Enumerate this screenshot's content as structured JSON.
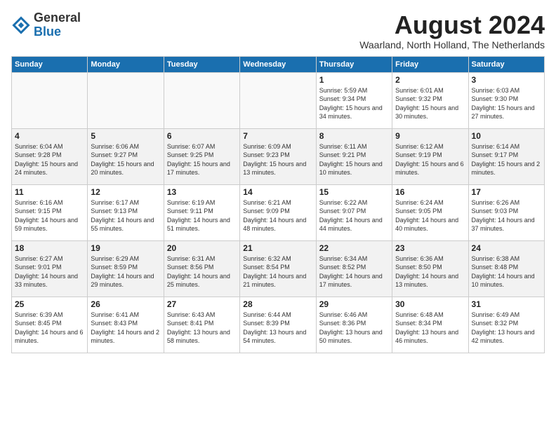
{
  "header": {
    "logo_general": "General",
    "logo_blue": "Blue",
    "month": "August 2024",
    "location": "Waarland, North Holland, The Netherlands"
  },
  "weekdays": [
    "Sunday",
    "Monday",
    "Tuesday",
    "Wednesday",
    "Thursday",
    "Friday",
    "Saturday"
  ],
  "weeks": [
    [
      {
        "day": "",
        "info": ""
      },
      {
        "day": "",
        "info": ""
      },
      {
        "day": "",
        "info": ""
      },
      {
        "day": "",
        "info": ""
      },
      {
        "day": "1",
        "info": "Sunrise: 5:59 AM\nSunset: 9:34 PM\nDaylight: 15 hours and 34 minutes."
      },
      {
        "day": "2",
        "info": "Sunrise: 6:01 AM\nSunset: 9:32 PM\nDaylight: 15 hours and 30 minutes."
      },
      {
        "day": "3",
        "info": "Sunrise: 6:03 AM\nSunset: 9:30 PM\nDaylight: 15 hours and 27 minutes."
      }
    ],
    [
      {
        "day": "4",
        "info": "Sunrise: 6:04 AM\nSunset: 9:28 PM\nDaylight: 15 hours and 24 minutes."
      },
      {
        "day": "5",
        "info": "Sunrise: 6:06 AM\nSunset: 9:27 PM\nDaylight: 15 hours and 20 minutes."
      },
      {
        "day": "6",
        "info": "Sunrise: 6:07 AM\nSunset: 9:25 PM\nDaylight: 15 hours and 17 minutes."
      },
      {
        "day": "7",
        "info": "Sunrise: 6:09 AM\nSunset: 9:23 PM\nDaylight: 15 hours and 13 minutes."
      },
      {
        "day": "8",
        "info": "Sunrise: 6:11 AM\nSunset: 9:21 PM\nDaylight: 15 hours and 10 minutes."
      },
      {
        "day": "9",
        "info": "Sunrise: 6:12 AM\nSunset: 9:19 PM\nDaylight: 15 hours and 6 minutes."
      },
      {
        "day": "10",
        "info": "Sunrise: 6:14 AM\nSunset: 9:17 PM\nDaylight: 15 hours and 2 minutes."
      }
    ],
    [
      {
        "day": "11",
        "info": "Sunrise: 6:16 AM\nSunset: 9:15 PM\nDaylight: 14 hours and 59 minutes."
      },
      {
        "day": "12",
        "info": "Sunrise: 6:17 AM\nSunset: 9:13 PM\nDaylight: 14 hours and 55 minutes."
      },
      {
        "day": "13",
        "info": "Sunrise: 6:19 AM\nSunset: 9:11 PM\nDaylight: 14 hours and 51 minutes."
      },
      {
        "day": "14",
        "info": "Sunrise: 6:21 AM\nSunset: 9:09 PM\nDaylight: 14 hours and 48 minutes."
      },
      {
        "day": "15",
        "info": "Sunrise: 6:22 AM\nSunset: 9:07 PM\nDaylight: 14 hours and 44 minutes."
      },
      {
        "day": "16",
        "info": "Sunrise: 6:24 AM\nSunset: 9:05 PM\nDaylight: 14 hours and 40 minutes."
      },
      {
        "day": "17",
        "info": "Sunrise: 6:26 AM\nSunset: 9:03 PM\nDaylight: 14 hours and 37 minutes."
      }
    ],
    [
      {
        "day": "18",
        "info": "Sunrise: 6:27 AM\nSunset: 9:01 PM\nDaylight: 14 hours and 33 minutes."
      },
      {
        "day": "19",
        "info": "Sunrise: 6:29 AM\nSunset: 8:59 PM\nDaylight: 14 hours and 29 minutes."
      },
      {
        "day": "20",
        "info": "Sunrise: 6:31 AM\nSunset: 8:56 PM\nDaylight: 14 hours and 25 minutes."
      },
      {
        "day": "21",
        "info": "Sunrise: 6:32 AM\nSunset: 8:54 PM\nDaylight: 14 hours and 21 minutes."
      },
      {
        "day": "22",
        "info": "Sunrise: 6:34 AM\nSunset: 8:52 PM\nDaylight: 14 hours and 17 minutes."
      },
      {
        "day": "23",
        "info": "Sunrise: 6:36 AM\nSunset: 8:50 PM\nDaylight: 14 hours and 13 minutes."
      },
      {
        "day": "24",
        "info": "Sunrise: 6:38 AM\nSunset: 8:48 PM\nDaylight: 14 hours and 10 minutes."
      }
    ],
    [
      {
        "day": "25",
        "info": "Sunrise: 6:39 AM\nSunset: 8:45 PM\nDaylight: 14 hours and 6 minutes."
      },
      {
        "day": "26",
        "info": "Sunrise: 6:41 AM\nSunset: 8:43 PM\nDaylight: 14 hours and 2 minutes."
      },
      {
        "day": "27",
        "info": "Sunrise: 6:43 AM\nSunset: 8:41 PM\nDaylight: 13 hours and 58 minutes."
      },
      {
        "day": "28",
        "info": "Sunrise: 6:44 AM\nSunset: 8:39 PM\nDaylight: 13 hours and 54 minutes."
      },
      {
        "day": "29",
        "info": "Sunrise: 6:46 AM\nSunset: 8:36 PM\nDaylight: 13 hours and 50 minutes."
      },
      {
        "day": "30",
        "info": "Sunrise: 6:48 AM\nSunset: 8:34 PM\nDaylight: 13 hours and 46 minutes."
      },
      {
        "day": "31",
        "info": "Sunrise: 6:49 AM\nSunset: 8:32 PM\nDaylight: 13 hours and 42 minutes."
      }
    ]
  ]
}
